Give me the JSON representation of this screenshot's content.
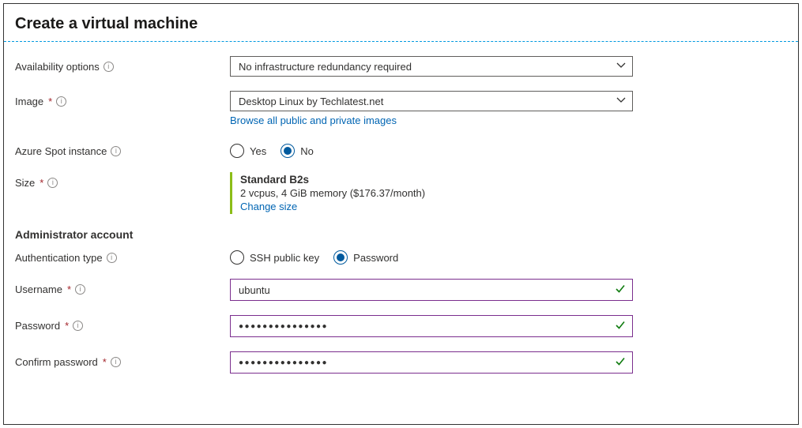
{
  "title": "Create a virtual machine",
  "fields": {
    "availability": {
      "label": "Availability options",
      "value": "No infrastructure redundancy required"
    },
    "image": {
      "label": "Image",
      "value": "Desktop Linux by Techlatest.net",
      "browse_link": "Browse all public and private images"
    },
    "spot": {
      "label": "Azure Spot instance",
      "yes": "Yes",
      "no": "No",
      "selected": "No"
    },
    "size": {
      "label": "Size",
      "name": "Standard B2s",
      "detail": "2 vcpus, 4 GiB memory ($176.37/month)",
      "change_link": "Change size"
    }
  },
  "admin": {
    "heading": "Administrator account",
    "auth": {
      "label": "Authentication type",
      "ssh": "SSH public key",
      "password": "Password",
      "selected": "Password"
    },
    "username": {
      "label": "Username",
      "value": "ubuntu"
    },
    "password": {
      "label": "Password",
      "value": "●●●●●●●●●●●●●●●"
    },
    "confirm": {
      "label": "Confirm password",
      "value": "●●●●●●●●●●●●●●●"
    }
  }
}
